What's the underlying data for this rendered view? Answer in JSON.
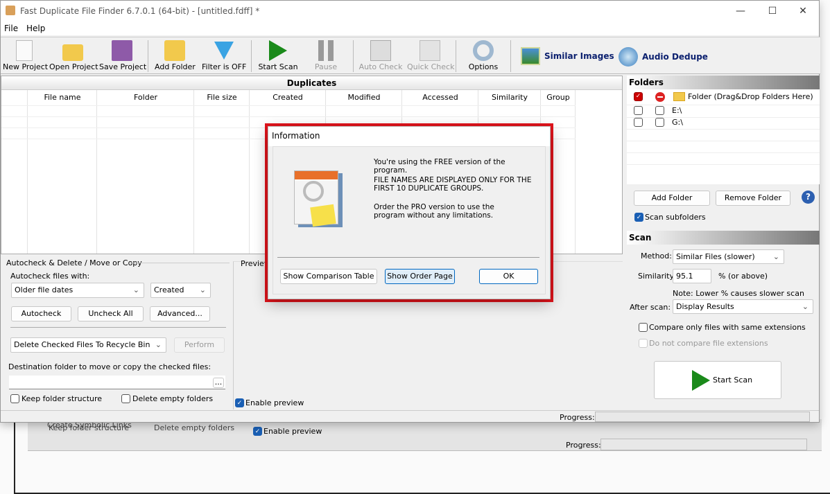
{
  "window": {
    "title": "Fast Duplicate File Finder 6.7.0.1 (64-bit) - [untitled.fdff] *",
    "minimize": "—",
    "maximize": "☐",
    "close": "✕"
  },
  "menu": [
    "File",
    "Help"
  ],
  "toolbar": {
    "new_project": "New Project",
    "open_project": "Open Project",
    "save_project": "Save Project",
    "add_folder": "Add Folder",
    "filter": "Filter is OFF",
    "start_scan": "Start Scan",
    "pause": "Pause",
    "auto_check": "Auto Check",
    "quick_check": "Quick Check",
    "options": "Options",
    "similar_images": "Similar Images",
    "audio_dedupe": "Audio Dedupe"
  },
  "duplicates": {
    "title": "Duplicates",
    "columns": [
      "File name",
      "Folder",
      "File size",
      "Created",
      "Modified",
      "Accessed",
      "Similarity",
      "Group"
    ]
  },
  "autocheck": {
    "title": "Autocheck & Delete / Move or Copy",
    "files_with_label": "Autocheck files with:",
    "criterion": "Older file dates",
    "date_type": "Created",
    "autocheck": "Autocheck",
    "uncheck_all": "Uncheck All",
    "advanced": "Advanced...",
    "action": "Delete Checked Files To Recycle Bin",
    "perform": "Perform",
    "dest_label": "Destination folder to move or copy the checked files:",
    "dest_value": "",
    "browse": "...",
    "keep_structure": "Keep folder structure",
    "delete_empty": "Delete empty folders"
  },
  "preview": {
    "title": "Preview",
    "enable": "Enable preview"
  },
  "folders": {
    "title": "Folders",
    "header": "Folder (Drag&Drop Folders Here)",
    "items": [
      {
        "path": "E:\\"
      },
      {
        "path": "G:\\"
      }
    ],
    "add": "Add Folder",
    "remove": "Remove Folder",
    "help": "?",
    "scan_subfolders": "Scan subfolders"
  },
  "scan": {
    "title": "Scan",
    "method_label": "Method:",
    "method": "Similar Files (slower)",
    "similarity_label": "Similarity:",
    "similarity": "95.1",
    "similarity_suffix": "% (or above)",
    "note": "Note: Lower % causes slower scan",
    "after_label": "After scan:",
    "after": "Display Results",
    "same_ext": "Compare only files with same extensions",
    "no_ext": "Do not compare file extensions",
    "start": "Start Scan"
  },
  "status": {
    "progress_label": "Progress:"
  },
  "background": {
    "keep": "Keep folder structure",
    "delete_empty": "Delete empty folders",
    "enable_preview": "Enable preview",
    "progress_label": "Progress:",
    "symlinks": "Create Symbolic Links"
  },
  "dialog": {
    "title": "Information",
    "line1": "You're using the FREE version of the program.",
    "line2": "FILE NAMES ARE DISPLAYED ONLY FOR THE FIRST 10 DUPLICATE GROUPS.",
    "line3": "Order the PRO version to use the program without any limitations.",
    "compare": "Show Comparison Table",
    "order": "Show Order Page",
    "ok": "OK"
  },
  "colors": {
    "highlight": "#e3141c",
    "accent": "#1a5fb4"
  }
}
